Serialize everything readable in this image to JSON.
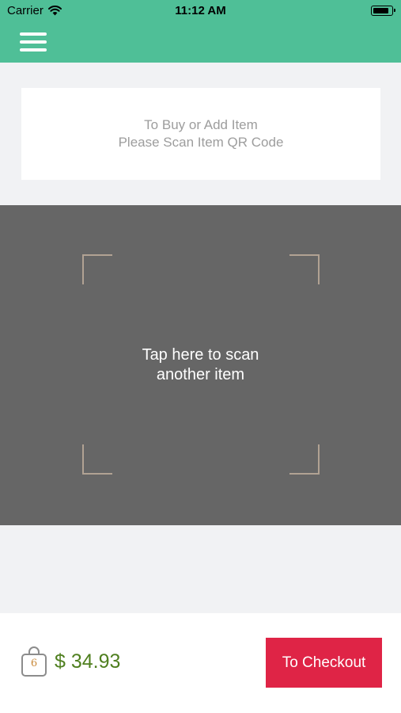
{
  "status_bar": {
    "carrier": "Carrier",
    "time": "11:12 AM"
  },
  "nav": {
    "menu_icon": "hamburger-menu-icon"
  },
  "instruction": {
    "line1": "To Buy or Add Item",
    "line2": "Please Scan Item QR Code"
  },
  "scanner": {
    "line1": "Tap here to scan",
    "line2": "another item"
  },
  "cart": {
    "icon": "shopping-bag-icon",
    "count": "6",
    "total": "$ 34.93"
  },
  "checkout": {
    "label": "To Checkout"
  },
  "colors": {
    "header": "#4fbf97",
    "scanner_bg": "#666666",
    "checkout": "#df2446",
    "total": "#4f7f1f"
  }
}
